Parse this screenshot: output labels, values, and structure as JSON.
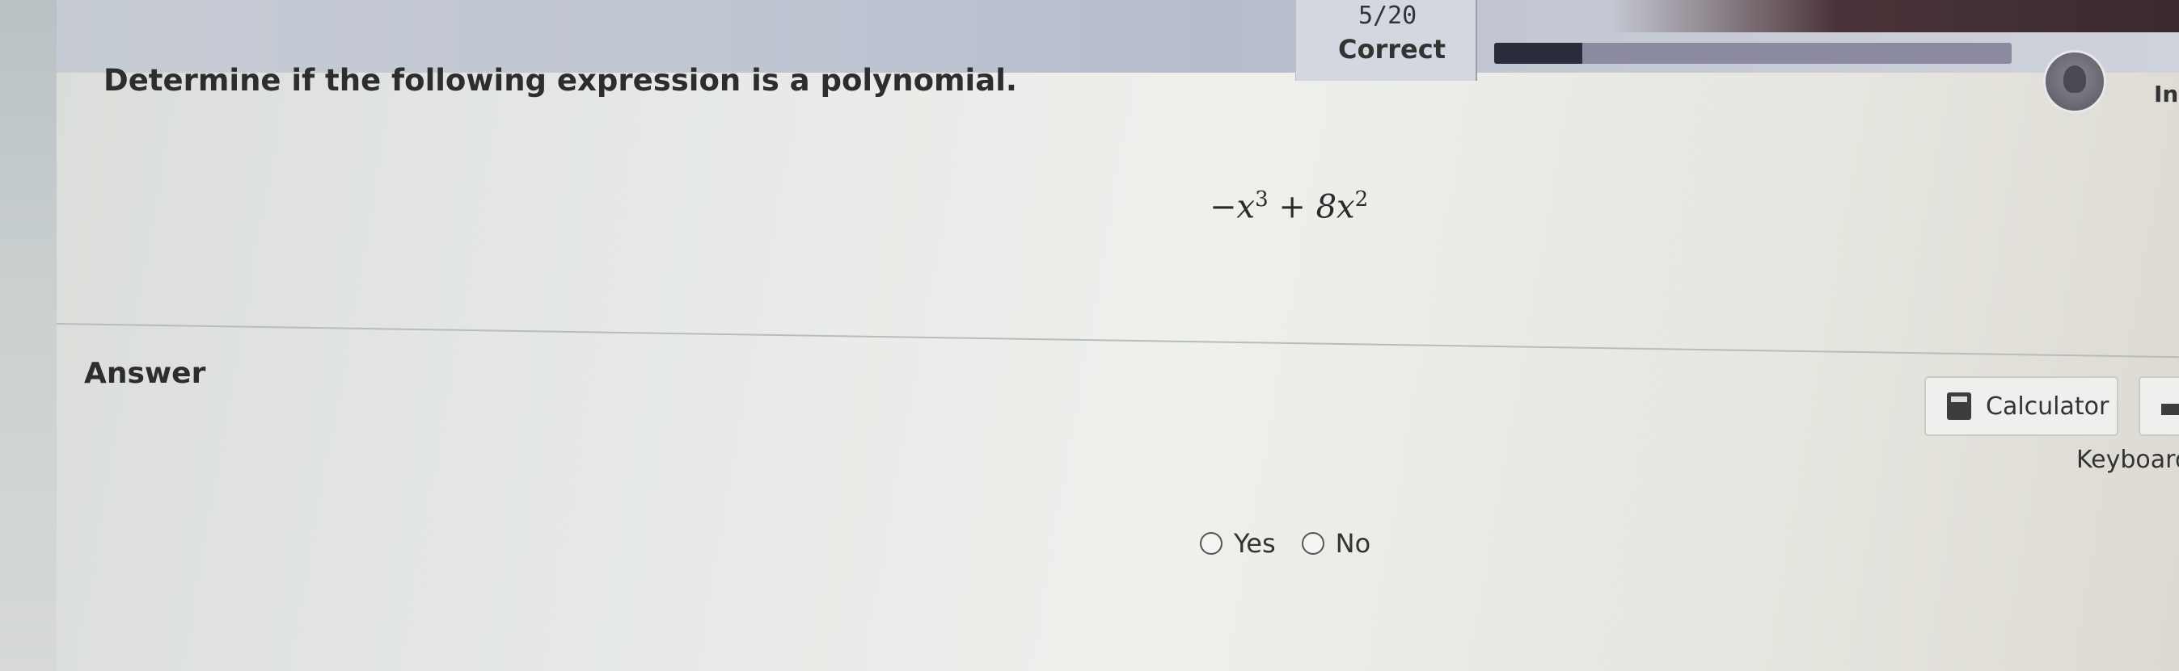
{
  "header": {
    "score": "5/20",
    "status": "Correct",
    "progress_fraction": 0.17,
    "avatar_icon": "user-avatar-icon",
    "truncated_label": "In"
  },
  "question": {
    "prompt": "Determine if the following expression is a polynomial.",
    "expression": {
      "term1_base": "−x",
      "term1_exp": "3",
      "operator": " + 8x",
      "term2_exp": "2"
    }
  },
  "answer": {
    "label": "Answer",
    "options": [
      "Yes",
      "No"
    ]
  },
  "tools": {
    "calculator_label": "Calculator",
    "calculator_icon": "calculator-icon",
    "keyboard_label": "Keyboard",
    "keyboard_icon": "keyboard-icon"
  }
}
